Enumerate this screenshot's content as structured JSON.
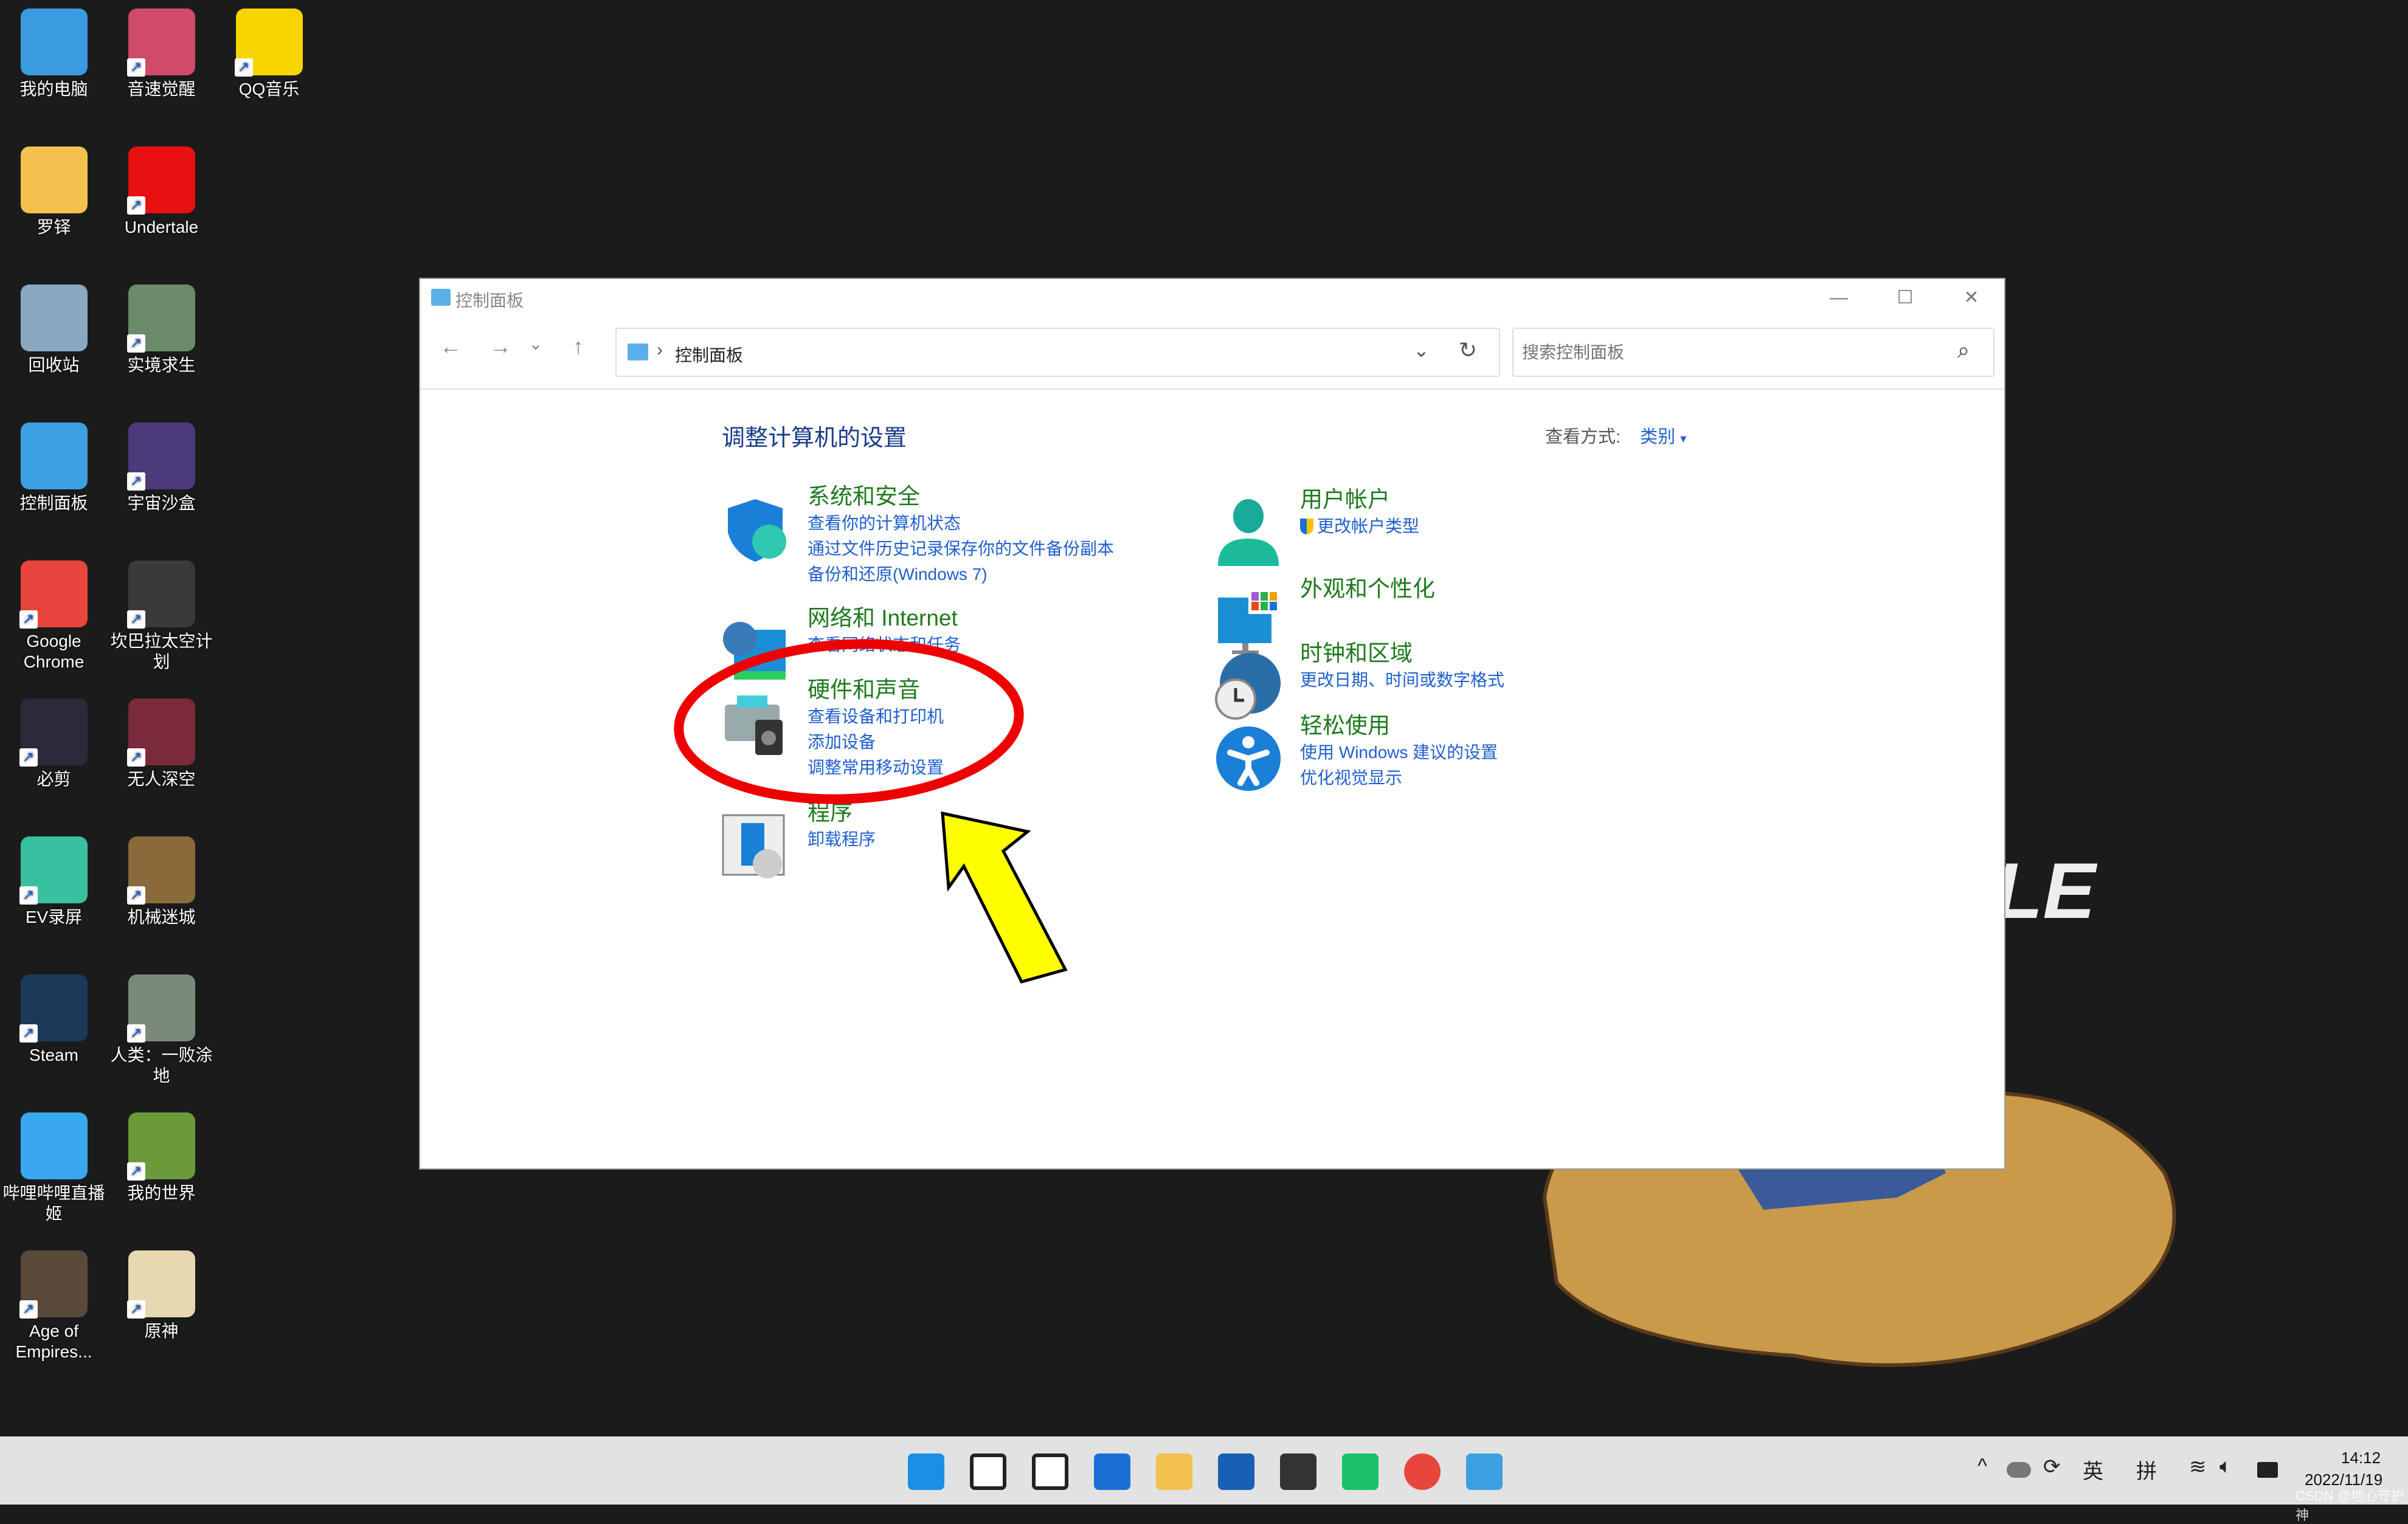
{
  "desktop": {
    "icons": [
      {
        "label": "我的电脑",
        "col": 0,
        "color": "#3a9be0"
      },
      {
        "label": "音速觉醒",
        "col": 1,
        "color": "#d04a6a",
        "shortcut": true
      },
      {
        "label": "QQ音乐",
        "col": 2,
        "color": "#f5d400",
        "shortcut": true
      },
      {
        "label": "罗铎",
        "col": 0,
        "color": "#f2c14e"
      },
      {
        "label": "Undertale",
        "col": 1,
        "color": "#e81010",
        "shortcut": true
      },
      {
        "label": "回收站",
        "col": 0,
        "color": "#8aa8c0"
      },
      {
        "label": "实境求生",
        "col": 1,
        "color": "#6b8a6a",
        "shortcut": true
      },
      {
        "label": "控制面板",
        "col": 0,
        "color": "#3aa0e0"
      },
      {
        "label": "宇宙沙盒",
        "col": 1,
        "color": "#4a3a7a",
        "shortcut": true
      },
      {
        "label": "Google Chrome",
        "col": 0,
        "color": "#e8453c",
        "shortcut": true
      },
      {
        "label": "坎巴拉太空计划",
        "col": 1,
        "color": "#3a3a3a",
        "shortcut": true
      },
      {
        "label": "必剪",
        "col": 0,
        "color": "#2a2a3a",
        "shortcut": true
      },
      {
        "label": "无人深空",
        "col": 1,
        "color": "#7a2a3a",
        "shortcut": true
      },
      {
        "label": "EV录屏",
        "col": 0,
        "color": "#39c0a0",
        "shortcut": true
      },
      {
        "label": "机械迷城",
        "col": 1,
        "color": "#8a6a3a",
        "shortcut": true
      },
      {
        "label": "Steam",
        "col": 0,
        "color": "#1b3a5a",
        "shortcut": true
      },
      {
        "label": "人类：一败涂地",
        "col": 1,
        "color": "#7a8a7a",
        "shortcut": true
      },
      {
        "label": "哔哩哔哩直播姬",
        "col": 0,
        "color": "#3aa8f0"
      },
      {
        "label": "我的世界",
        "col": 1,
        "color": "#6a9a3a",
        "shortcut": true
      },
      {
        "label": "Age of Empires...",
        "col": 0,
        "color": "#5a4a3a",
        "shortcut": true
      },
      {
        "label": "原神",
        "col": 1,
        "color": "#e8d8b0",
        "shortcut": true
      }
    ],
    "wallpaper_text": "LE"
  },
  "window": {
    "title": "控制面板",
    "minimize": "—",
    "maximize": "☐",
    "close": "✕",
    "nav": {
      "back": "←",
      "forward": "→",
      "recent": "⌄",
      "up": "↑"
    },
    "address": {
      "separator": "›",
      "path": "控制面板",
      "dropdown": "⌄",
      "refresh": "↻"
    },
    "search": {
      "placeholder": "搜索控制面板",
      "icon": "⌕"
    },
    "heading": "调整计算机的设置",
    "view_by": {
      "label": "查看方式:",
      "value": "类别",
      "arrow": "▾"
    },
    "categories_left": [
      {
        "title": "系统和安全",
        "icon": "shield-icon",
        "links": [
          "查看你的计算机状态",
          "通过文件历史记录保存你的文件备份副本",
          "备份和还原(Windows 7)"
        ]
      },
      {
        "title": "网络和 Internet",
        "icon": "network-icon",
        "links": [
          "查看网络状态和任务"
        ]
      },
      {
        "title": "硬件和声音",
        "icon": "printer-icon",
        "links": [
          "查看设备和打印机",
          "添加设备",
          "调整常用移动设置"
        ]
      },
      {
        "title": "程序",
        "icon": "programs-icon",
        "links": [
          "卸载程序"
        ]
      }
    ],
    "categories_right": [
      {
        "title": "用户帐户",
        "icon": "user-icon",
        "links": [
          "更改帐户类型"
        ]
      },
      {
        "title": "外观和个性化",
        "icon": "appearance-icon",
        "links": []
      },
      {
        "title": "时钟和区域",
        "icon": "clock-globe-icon",
        "links": [
          "更改日期、时间或数字格式"
        ]
      },
      {
        "title": "轻松使用",
        "icon": "accessibility-icon",
        "links": [
          "使用 Windows 建议的设置",
          "优化视觉显示"
        ]
      }
    ]
  },
  "annotation": {
    "ellipse_color": "#ee0000",
    "arrow_color": "#ffff00"
  },
  "taskbar": {
    "apps": [
      "start",
      "search",
      "task-view",
      "widgets",
      "file-explorer",
      "store",
      "unity",
      "wechat-app",
      "chrome",
      "control-panel"
    ],
    "tray": {
      "chevron": "^",
      "ime_lang": "英",
      "ime_mode": "拼",
      "time": "14:12",
      "date": "2022/11/19",
      "watermark": "CSDN @地心守护神"
    }
  }
}
